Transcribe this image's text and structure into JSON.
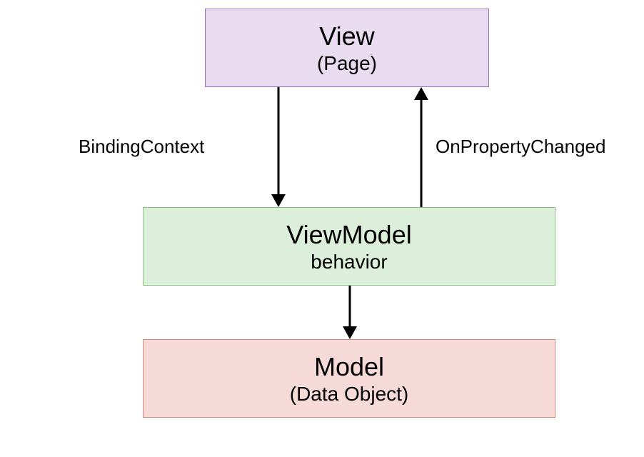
{
  "boxes": {
    "view": {
      "title": "View",
      "subtitle": "(Page)"
    },
    "viewmodel": {
      "title": "ViewModel",
      "subtitle": "behavior"
    },
    "model": {
      "title": "Model",
      "subtitle": "(Data Object)"
    }
  },
  "labels": {
    "bindingContext": "BindingContext",
    "onPropertyChanged": "OnPropertyChanged"
  },
  "colors": {
    "viewFill": "#e9dcf1",
    "viewBorder": "#9b6fb5",
    "viewModelFill": "#dcefda",
    "viewModelBorder": "#8bbf7d",
    "modelFill": "#f6dad8",
    "modelBorder": "#d6857b"
  }
}
